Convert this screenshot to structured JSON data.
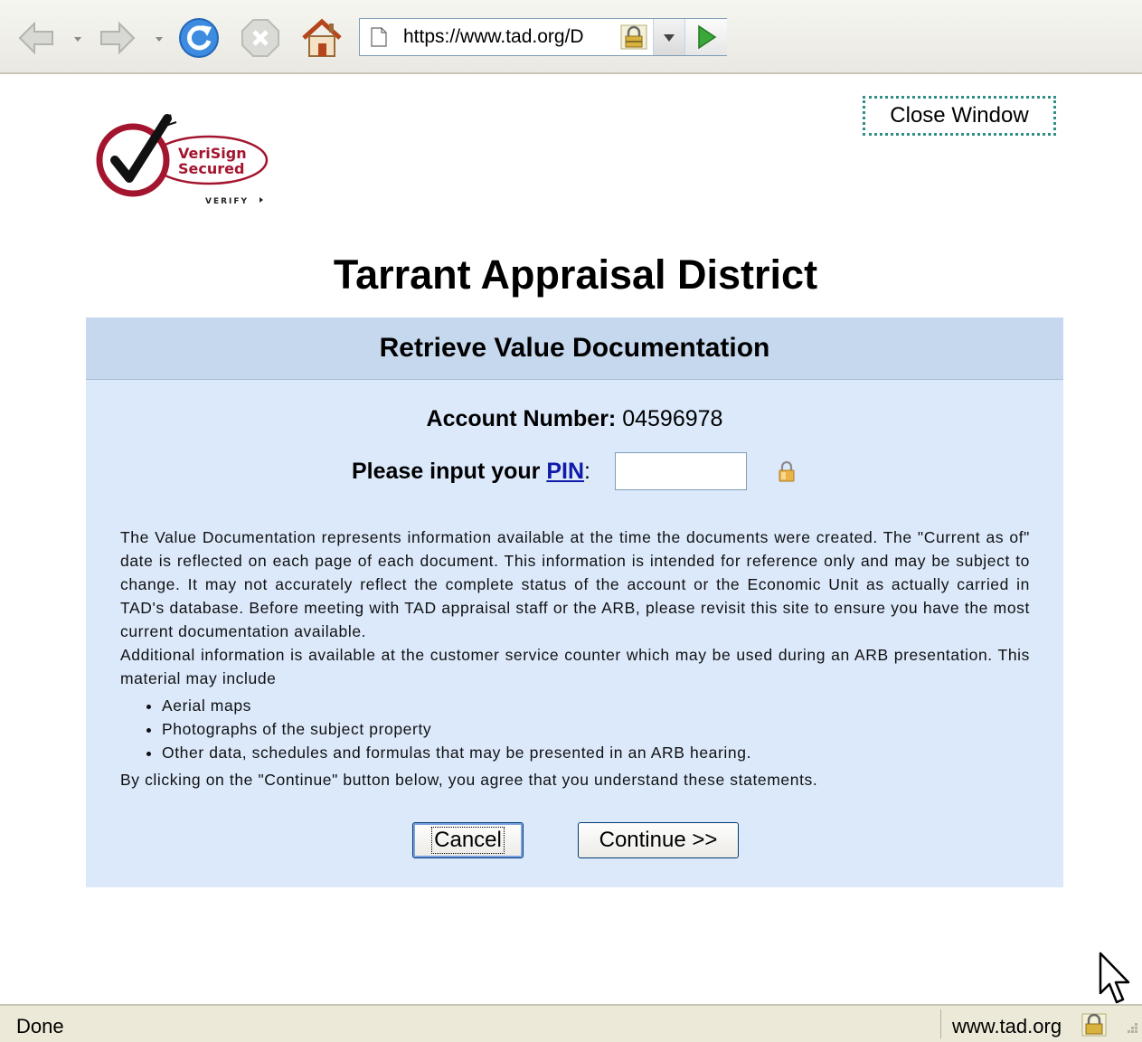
{
  "browser": {
    "url": "https://www.tad.org/D",
    "status_text": "Done",
    "status_domain": "www.tad.org"
  },
  "page": {
    "close_window_label": "Close Window",
    "title": "Tarrant Appraisal District",
    "panel_title": "Retrieve Value Documentation",
    "account_label": "Account Number:",
    "account_number": "04596978",
    "pin_prefix": "Please input your ",
    "pin_link": "PIN",
    "pin_suffix": ":",
    "pin_value": "",
    "paragraph1": "The Value Documentation represents information available at the time the documents were created. The \"Current as of\" date is reflected on each page of each document. This information is intended for reference only and may be subject to change. It may not accurately reflect the complete status of the account or the Economic Unit as actually carried in TAD's database. Before meeting with TAD appraisal staff or the ARB, please revisit this site to ensure you have the most current documentation available.",
    "paragraph2": "Additional information is available at the customer service counter which may be used during an ARB presentation. This material may include",
    "list_items": [
      "Aerial maps",
      "Photographs of the subject property",
      "Other data, schedules and formulas that may be presented in an ARB hearing."
    ],
    "paragraph3": "By clicking on the \"Continue\" button below, you agree that you understand these statements.",
    "cancel_label": "Cancel",
    "continue_label": "Continue >>"
  },
  "logo": {
    "text_line1": "VeriSign",
    "text_line2": "Secured",
    "text_line3": "VERIFY"
  },
  "icons": {
    "back": "back-arrow-icon",
    "forward": "forward-arrow-icon",
    "reload": "reload-icon",
    "stop": "stop-icon",
    "home": "home-icon",
    "page": "page-icon",
    "lock": "padlock-icon",
    "go": "go-arrow-icon"
  },
  "colors": {
    "panel_bg": "#dbe9fb",
    "panel_header_bg": "#c6d8ee",
    "link": "#0f1aa8",
    "verisign_red": "#a3152f"
  }
}
